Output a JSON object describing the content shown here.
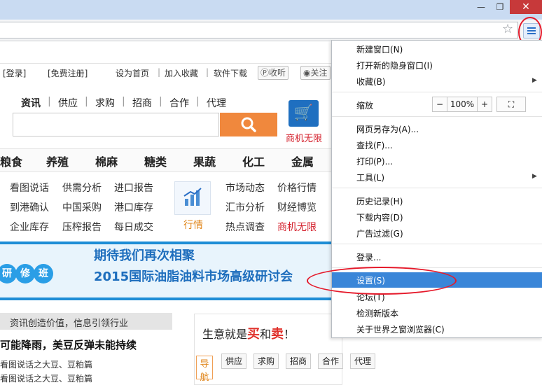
{
  "window": {
    "minimize": "—",
    "maximize": "❐",
    "close": "✕"
  },
  "toolbar": {
    "star_icon": "star-icon",
    "menu_icon": "menu-icon"
  },
  "top_links": {
    "login": "[登录]",
    "register": "[免费注册]",
    "set_home": "设为首页",
    "add_fav": "加入收藏",
    "software": "软件下载",
    "mobile": "收听",
    "weibo": "关注"
  },
  "search": {
    "categories": [
      "资讯",
      "供应",
      "求购",
      "招商",
      "合作",
      "代理"
    ],
    "placeholder": "",
    "button_icon": "search-icon",
    "cart_label": "商机无限"
  },
  "main_categories": [
    "粮食",
    "养殖",
    "棉麻",
    "糖类",
    "果蔬",
    "化工",
    "金属"
  ],
  "links": {
    "col1": [
      "看图说话",
      "到港确认",
      "企业库存"
    ],
    "col2": [
      "供需分析",
      "中国采购",
      "压榨报告"
    ],
    "col3": [
      "进口报告",
      "港口库存",
      "每日成交"
    ],
    "hangqing": "行情",
    "col4": [
      "市场动态",
      "汇市分析",
      "热点调查"
    ],
    "col5": [
      "价格行情",
      "财经博览",
      "商机无限"
    ]
  },
  "banner": {
    "line1": "期待我们再次相聚",
    "line2": "2015国际油脂油料市场高级研讨会",
    "bubbles": [
      "研",
      "修",
      "班"
    ]
  },
  "news": {
    "slogan": "资讯创造价值，信息引领行业",
    "headline": "可能降雨，美豆反弹未能持续",
    "item1": "看图说话之大豆、豆粕篇",
    "item2": "看图说话之大豆、豆粕篇"
  },
  "trade": {
    "title_pre": "生意就是",
    "buy": "买",
    "and": "和",
    "sell": "卖",
    "excl": "！",
    "guide": "导航",
    "tags": [
      "供应",
      "求购",
      "招商",
      "合作",
      "代理"
    ]
  },
  "menu": {
    "new_window": "新建窗口(N)",
    "incognito": "打开新的隐身窗口(I)",
    "bookmarks": "收藏(B)",
    "zoom": "缩放",
    "zoom_minus": "−",
    "zoom_value": "100%",
    "zoom_plus": "+",
    "fullscreen": "⛶",
    "save_as": "网页另存为(A)...",
    "find": "查找(F)...",
    "print": "打印(P)...",
    "tools": "工具(L)",
    "history": "历史记录(H)",
    "downloads": "下载内容(D)",
    "adblock": "广告过滤(G)",
    "login": "登录...",
    "settings": "设置(S)",
    "forum": "论坛(T)",
    "update": "检测新版本",
    "about": "关于世界之窗浏览器(C)",
    "submenu_arrow": "▶"
  },
  "colors": {
    "accent": "#3a86d8",
    "highlight_ring": "#e5192a",
    "search_orange": "#f0883d",
    "banner_blue": "#1e8dd6"
  }
}
